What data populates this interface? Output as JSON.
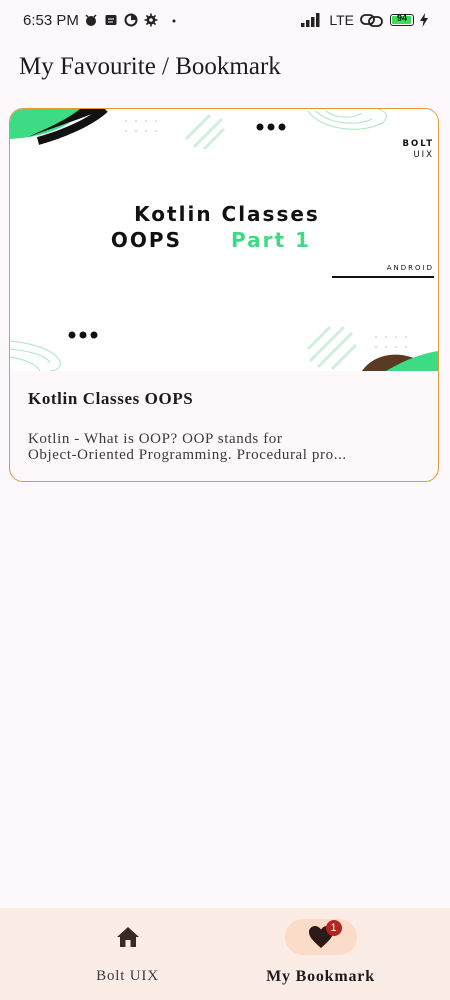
{
  "status_bar": {
    "time": "6:53 PM",
    "network": "LTE",
    "battery": "94",
    "icons": [
      "alarm-icon",
      "message-icon",
      "data-saver-icon",
      "settings-icon",
      "dot-icon",
      "signal-icon",
      "link-icon",
      "charging-icon"
    ]
  },
  "page": {
    "title": "My Favourite / Bookmark"
  },
  "card": {
    "image": {
      "brand_line1": "BOLT",
      "brand_line2": "UIX",
      "heading_line1": "Kotlin Classes",
      "heading_line2_a": "OOPS",
      "heading_line2_b": "Part 1",
      "tag": "ANDROID",
      "accent_color": "#3ddc84"
    },
    "title": "Kotlin Classes OOPS",
    "description_line1": "Kotlin - What is OOP? OOP stands for",
    "description_line2": "Object-Oriented Programming. Procedural pro..."
  },
  "nav": {
    "items": [
      {
        "label": "Bolt UIX",
        "icon": "home-icon"
      },
      {
        "label": "My Bookmark",
        "icon": "heart-icon",
        "badge": "1"
      }
    ]
  },
  "colors": {
    "card_border": "#e39a3a",
    "nav_bg": "#fcece6",
    "nav_indicator": "#fbdcc8",
    "badge": "#b3261e"
  }
}
